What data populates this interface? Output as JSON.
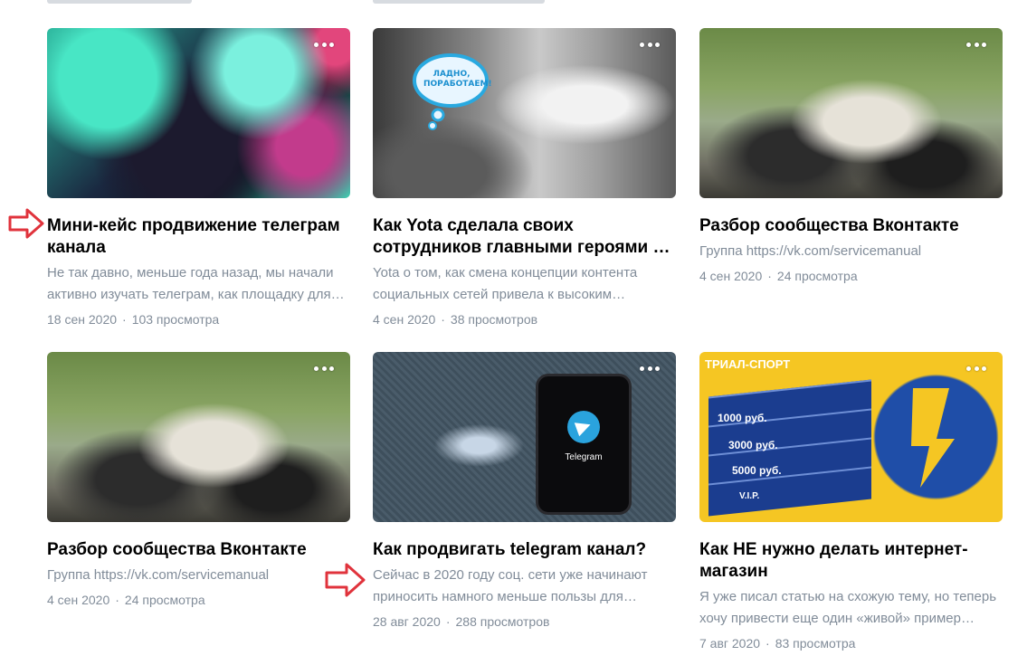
{
  "colors": {
    "title": "#000000",
    "secondary": "#818c99",
    "arrow": "#e0333c"
  },
  "cards": [
    {
      "title": "Мини-кейс продвижение телеграм канала",
      "description": "Не так давно, меньше года назад, мы начали активно изучать телеграм, как площадку для продвижения…",
      "date": "18 сен 2020",
      "views": "103 просмотра",
      "image": "abstract-paint-image",
      "menu_icon": "more-dots-icon"
    },
    {
      "title": "Как Yota сделала своих сотрудников главными героями в рекламе",
      "description": "Yota о том, как смена концепции контента социальных сетей привела к высоким результатам",
      "date": "4 сен 2020",
      "views": "38 просмотров",
      "image": "yota-man-image",
      "badge": "ЛАДНО, ПОРАБОТАЕМ!",
      "menu_icon": "more-dots-icon"
    },
    {
      "title": "Разбор сообщества Вконтакте",
      "description": "Группа https://vk.com/servicemanual",
      "date": "4 сен 2020",
      "views": "24 просмотра",
      "image": "motorcycle-image",
      "menu_icon": "more-dots-icon"
    },
    {
      "title": "Разбор сообщества Вконтакте",
      "description": "Группа https://vk.com/servicemanual",
      "date": "4 сен 2020",
      "views": "24 просмотра",
      "image": "motorcycle-image",
      "menu_icon": "more-dots-icon"
    },
    {
      "title": "Как продвигать telegram канал?",
      "description": "Сейчас в 2020 году соц. сети уже начинают приносить намного меньше пользы для бизнеса…",
      "date": "28 авг 2020",
      "views": "288 просмотров",
      "image": "telegram-phone-image",
      "phone_label": "Telegram",
      "menu_icon": "more-dots-icon"
    },
    {
      "title": "Как НЕ нужно делать интернет-магазин",
      "description": "Я уже писал статью на схожую тему, но теперь хочу привести еще один «живой» пример…",
      "date": "7 авг 2020",
      "views": "83 просмотра",
      "image": "gift-certificate-image",
      "cert_brand": "ТРИАЛ-СПОРТ",
      "cert_values": [
        "1000 руб.",
        "3000 руб.",
        "5000 руб.",
        "V.I.P."
      ],
      "menu_icon": "more-dots-icon"
    }
  ]
}
